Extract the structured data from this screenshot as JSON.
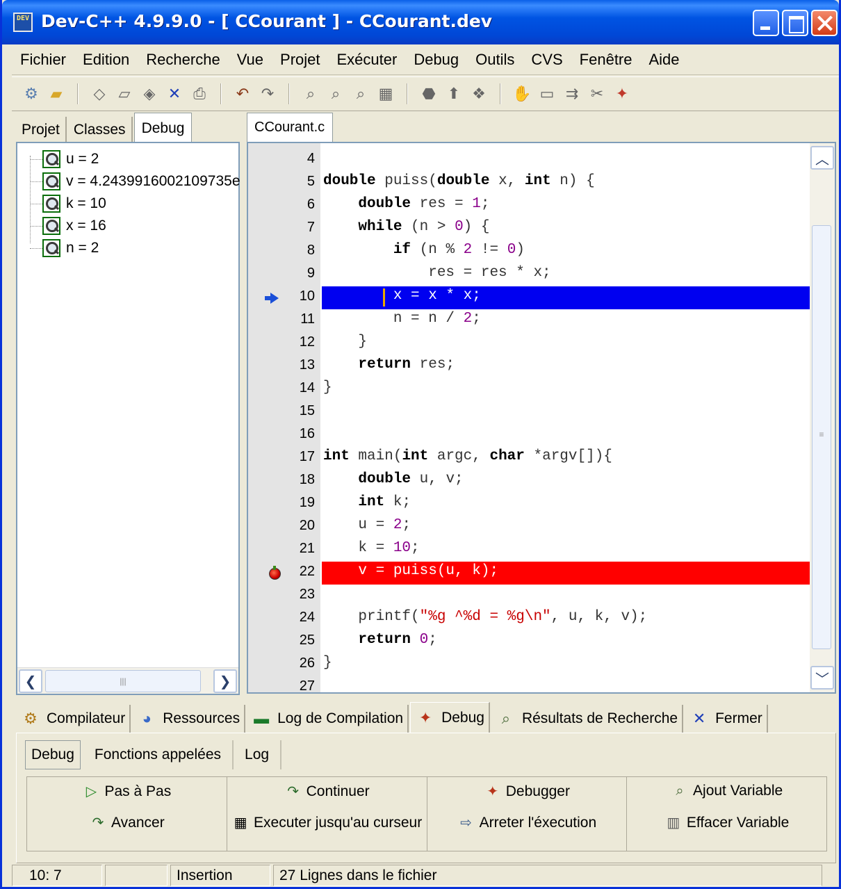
{
  "window": {
    "title": "Dev-C++ 4.9.9.0  - [ CCourant ] - CCourant.dev",
    "icon_text": "DEV"
  },
  "menu": [
    {
      "label": "Fichier"
    },
    {
      "label": "Edition"
    },
    {
      "label": "Recherche"
    },
    {
      "label": "Vue"
    },
    {
      "label": "Projet"
    },
    {
      "label": "Exécuter"
    },
    {
      "label": "Debug"
    },
    {
      "label": "Outils"
    },
    {
      "label": "CVS"
    },
    {
      "label": "Fenêtre"
    },
    {
      "label": "Aide"
    }
  ],
  "toolbar": {
    "icons": [
      "new-project-icon",
      "open-folder-icon",
      "new-file-icon",
      "save-icon",
      "save-all-icon",
      "close-icon",
      "print-icon",
      "undo-icon",
      "redo-icon",
      "find-icon",
      "replace-icon",
      "find-next-icon",
      "goto-line-icon",
      "compile-icon",
      "run-icon",
      "compile-run-icon",
      "rebuild-icon",
      "debug-icon"
    ]
  },
  "left_tabs": [
    {
      "label": "Projet",
      "active": false
    },
    {
      "label": "Classes",
      "active": false
    },
    {
      "label": "Debug",
      "active": true
    }
  ],
  "watch_vars": [
    {
      "text": "u = 2"
    },
    {
      "text": "v = 4.2439916002109735e"
    },
    {
      "text": "k = 10"
    },
    {
      "text": "x = 16"
    },
    {
      "text": "n = 2"
    }
  ],
  "editor": {
    "tab_label": "CCourant.c",
    "current_line": 10,
    "breakpoint_line": 22,
    "line_numbers": [
      "4",
      "5",
      "6",
      "7",
      "8",
      "9",
      "10",
      "11",
      "12",
      "13",
      "14",
      "15",
      "16",
      "17",
      "18",
      "19",
      "20",
      "21",
      "22",
      "23",
      "24",
      "25",
      "26",
      "27"
    ]
  },
  "bottom_tabs": [
    {
      "label": "Compilateur",
      "icon": "compiler-icon"
    },
    {
      "label": "Ressources",
      "icon": "resources-icon"
    },
    {
      "label": "Log de Compilation",
      "icon": "log-icon"
    },
    {
      "label": "Debug",
      "icon": "debug-bug-icon",
      "active": true
    },
    {
      "label": "Résultats de Recherche",
      "icon": "search-results-icon"
    },
    {
      "label": "Fermer",
      "icon": "close-x-icon"
    }
  ],
  "debug_subtabs": [
    {
      "label": "Debug",
      "active": true
    },
    {
      "label": "Fonctions appelées"
    },
    {
      "label": "Log"
    }
  ],
  "debug_buttons": {
    "step": "Pas à Pas",
    "next": "Avancer",
    "continue": "Continuer",
    "run_to_cursor": "Executer jusqu'au curseur",
    "debug": "Debugger",
    "stop": "Arreter l'éxecution",
    "add_watch": "Ajout Variable",
    "remove_watch": "Effacer Variable"
  },
  "status": {
    "position": "10: 7",
    "modified": "",
    "mode": "Insertion",
    "lines": "27 Lignes dans le fichier"
  },
  "colors": {
    "current_line": "#0000f0",
    "breakpoint_line": "#ff0000",
    "keyword": "#000000",
    "number": "#8a008a",
    "string": "#c80000"
  }
}
